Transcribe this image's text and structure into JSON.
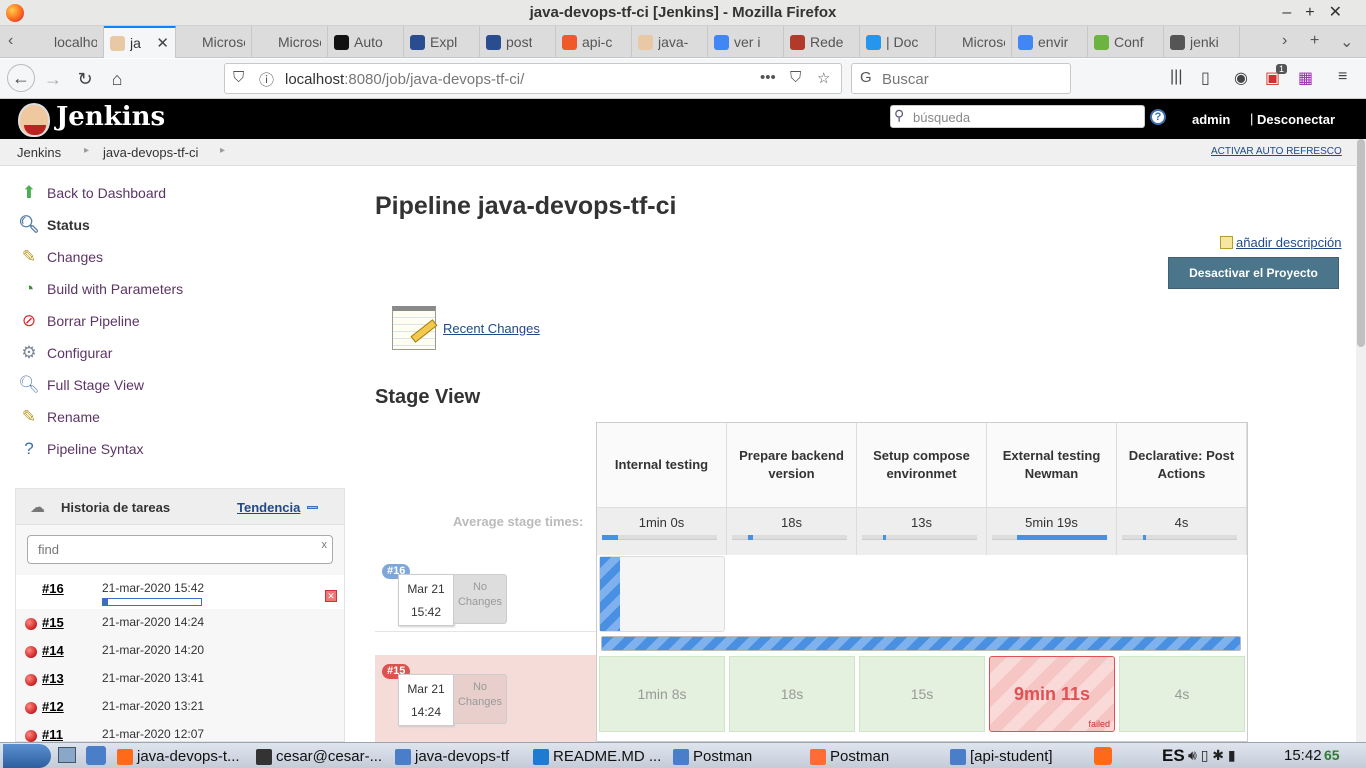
{
  "window": {
    "title": "java-devops-tf-ci [Jenkins] - Mozilla Firefox"
  },
  "tabs": [
    {
      "label": "localhos",
      "color": "#dcdcdc"
    },
    {
      "label": "ja",
      "color": "#e9c9a5",
      "active": true
    },
    {
      "label": "Microse",
      "color": "#dcdcdc"
    },
    {
      "label": "Microse",
      "color": "#dcdcdc"
    },
    {
      "label": "Auto",
      "color": "#111111"
    },
    {
      "label": "Expl",
      "color": "#2a4d8f"
    },
    {
      "label": "post",
      "color": "#2a4d8f"
    },
    {
      "label": "api-c",
      "color": "#f05a28"
    },
    {
      "label": "java-",
      "color": "#e9c9a5"
    },
    {
      "label": "ver i",
      "color": "#4285f4"
    },
    {
      "label": "Rede",
      "color": "#b23a2b"
    },
    {
      "label": "| Doc",
      "color": "#2496ed"
    },
    {
      "label": "Microse",
      "color": "#dcdcdc"
    },
    {
      "label": "envir",
      "color": "#4285f4"
    },
    {
      "label": "Conf",
      "color": "#6db33f"
    },
    {
      "label": "jenki",
      "color": "#555555"
    }
  ],
  "nav": {
    "url_host": "localhost",
    "url_rest": ":8080/job/java-devops-tf-ci/",
    "search_placeholder": "Buscar",
    "badge_count": "1"
  },
  "jenkins": {
    "brand": "Jenkins",
    "search_placeholder": "búsqueda",
    "user": "admin",
    "separator": "|",
    "logout": "Desconectar"
  },
  "breadcrumb": {
    "items": [
      "Jenkins",
      "java-devops-tf-ci"
    ],
    "auto_refresh": "ACTIVAR AUTO REFRESCO"
  },
  "sidebar": {
    "items": [
      {
        "label": "Back to Dashboard",
        "icon": "up-arrow-icon"
      },
      {
        "label": "Status",
        "icon": "magnifier-icon"
      },
      {
        "label": "Changes",
        "icon": "notepad-icon"
      },
      {
        "label": "Build with Parameters",
        "icon": "clock-play-icon"
      },
      {
        "label": "Borrar Pipeline",
        "icon": "no-entry-icon"
      },
      {
        "label": "Configurar",
        "icon": "gear-icon"
      },
      {
        "label": "Full Stage View",
        "icon": "magnifier-icon"
      },
      {
        "label": "Rename",
        "icon": "notepad-icon"
      },
      {
        "label": "Pipeline Syntax",
        "icon": "help-icon"
      }
    ]
  },
  "build_history": {
    "title": "Historia de tareas",
    "trend": "Tendencia",
    "find_placeholder": "find",
    "clear": "x",
    "builds": [
      {
        "num": "#16",
        "date": "21-mar-2020 15:42",
        "running": true,
        "progress": 0.05
      },
      {
        "num": "#15",
        "date": "21-mar-2020 14:24"
      },
      {
        "num": "#14",
        "date": "21-mar-2020 14:20"
      },
      {
        "num": "#13",
        "date": "21-mar-2020 13:41"
      },
      {
        "num": "#12",
        "date": "21-mar-2020 13:21"
      },
      {
        "num": "#11",
        "date": "21-mar-2020 12:07"
      }
    ]
  },
  "main": {
    "title": "Pipeline java-devops-tf-ci",
    "add_description": "añadir descripción",
    "disable_button": "Desactivar el Proyecto",
    "recent_changes": "Recent Changes",
    "stage_view_title": "Stage View"
  },
  "stage_view": {
    "avg_label": "Average stage times:",
    "stages": [
      {
        "name": "Internal testing",
        "avg": "1min 0s",
        "avg_bar_offset": 0.0,
        "avg_bar_fraction": 0.14
      },
      {
        "name": "Prepare backend version",
        "avg": "18s",
        "avg_bar_offset": 0.14,
        "avg_bar_fraction": 0.04
      },
      {
        "name": "Setup compose environmet",
        "avg": "13s",
        "avg_bar_offset": 0.18,
        "avg_bar_fraction": 0.03
      },
      {
        "name": "External testing Newman",
        "avg": "5min 19s",
        "avg_bar_offset": 0.22,
        "avg_bar_fraction": 0.78
      },
      {
        "name": "Declarative: Post Actions",
        "avg": "4s",
        "avg_bar_offset": 0.18,
        "avg_bar_fraction": 0.01
      }
    ],
    "runs": [
      {
        "badge": "#16",
        "date": "Mar 21",
        "time": "15:42",
        "changes": "No Changes",
        "status": "running",
        "cells": [
          "",
          "",
          "",
          "",
          ""
        ]
      },
      {
        "badge": "#15",
        "date": "Mar 21",
        "time": "14:24",
        "changes": "No Changes",
        "status": "failed",
        "cells": [
          "1min 8s",
          "18s",
          "15s",
          "9min 11s",
          "4s"
        ],
        "failed_label": "failed"
      }
    ]
  },
  "taskbar": {
    "items": [
      {
        "label": "java-devops-t...",
        "color": "#ff6a1a"
      },
      {
        "label": "cesar@cesar-...",
        "color": "#333333"
      },
      {
        "label": "java-devops-tf",
        "color": "#4a7ec8"
      },
      {
        "label": "README.MD ...",
        "color": "#1f7bd1"
      },
      {
        "label": "Postman",
        "color": "#4a7ec8"
      },
      {
        "label": "Postman",
        "color": "#ff6c37"
      },
      {
        "label": "[api-student]",
        "color": "#4a7ec8"
      }
    ],
    "lang": "ES",
    "time": "15:42",
    "battery": "65"
  }
}
